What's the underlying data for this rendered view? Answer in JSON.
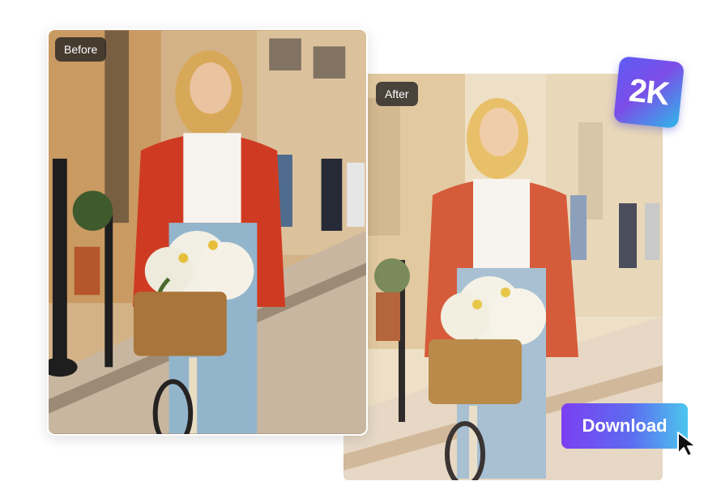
{
  "labels": {
    "before": "Before",
    "after": "After"
  },
  "badge": {
    "text": "2K"
  },
  "actions": {
    "download_label": "Download"
  },
  "colors": {
    "badge_gradient": [
      "#5d5cf4",
      "#2fb6e8"
    ],
    "button_gradient": [
      "#7b3ff2",
      "#4cc6ee"
    ],
    "tag_background": "#282624"
  },
  "icons": {
    "cursor": "pointer-cursor-icon"
  }
}
